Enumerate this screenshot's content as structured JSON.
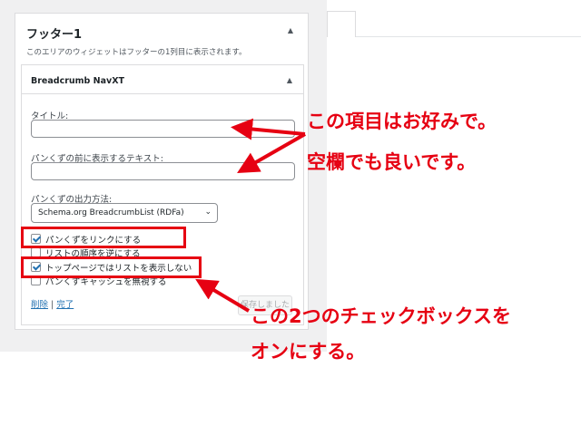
{
  "sidebar_area": {
    "title": "フッター1",
    "description": "このエリアのウィジェットはフッターの1列目に表示されます。"
  },
  "widget": {
    "title": "Breadcrumb NavXT",
    "fields": {
      "title_label": "タイトル:",
      "title_value": "",
      "prefix_label": "パンくずの前に表示するテキスト:",
      "prefix_value": "",
      "output_label": "パンくずの出力方法:",
      "output_value": "Schema.org BreadcrumbList (RDFa)"
    },
    "checkboxes": [
      {
        "label": "パンくずをリンクにする",
        "checked": true
      },
      {
        "label": "リストの順序を逆にする",
        "checked": false
      },
      {
        "label": "トップページではリストを表示しない",
        "checked": true
      },
      {
        "label": "パンくずキャッシュを無視する",
        "checked": false
      }
    ],
    "delete_link": "削除",
    "separator": "|",
    "done_link": "完了",
    "save_button": "保存しました"
  },
  "annotations": {
    "note1_line1": "この項目はお好みで。",
    "note1_line2": "空欄でも良いです。",
    "note2_line1": "この2つのチェックボックスを",
    "note2_line2": "オンにする。",
    "color": "#e60012"
  },
  "colors": {
    "link": "#2271b1",
    "annotation_red": "#e60012",
    "admin_bg": "#f0f0f1"
  }
}
